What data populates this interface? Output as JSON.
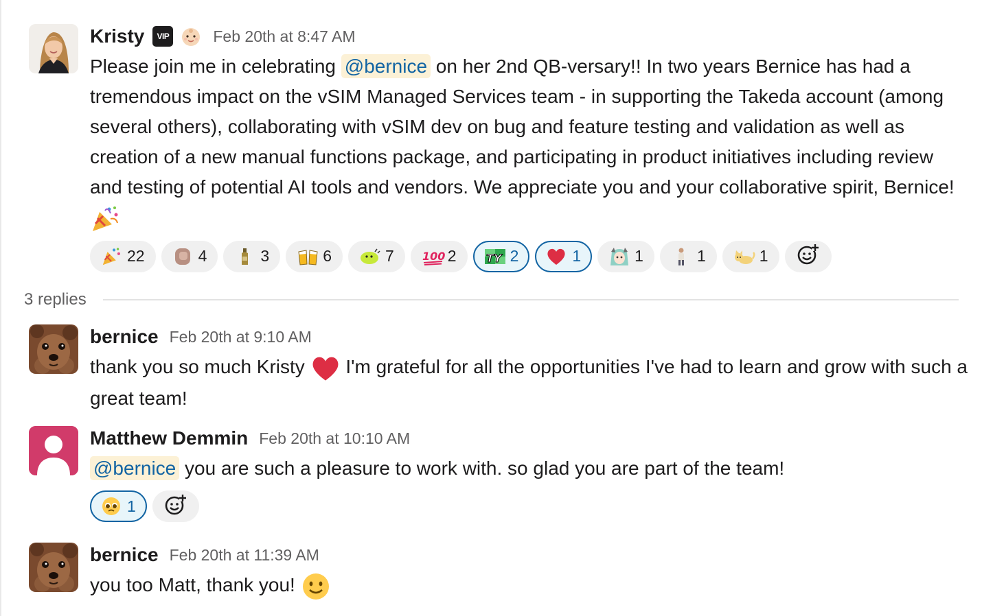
{
  "main_message": {
    "author": "Kristy",
    "badge": "VIP",
    "timestamp": "Feb 20th at 8:47 AM",
    "text_before": "Please join me in celebrating ",
    "mention": "@bernice",
    "text_after": " on her 2nd QB-versary!! In two years Bernice has had a tremendous impact on the vSIM Managed Services team - in supporting the Takeda account (among several others), collaborating with vSIM dev on bug and feature testing and validation as well as creation of a new manual functions package, and participating in product initiatives including review and testing of potential AI tools and vendors. We appreciate you and your collaborative spirit, Bernice! ",
    "reactions": [
      {
        "emoji": "party-popper",
        "count": "22",
        "mine": false
      },
      {
        "emoji": "custom-face",
        "count": "4",
        "mine": false
      },
      {
        "emoji": "bottle",
        "count": "3",
        "mine": false
      },
      {
        "emoji": "beers",
        "count": "6",
        "mine": false
      },
      {
        "emoji": "blob-dance",
        "count": "7",
        "mine": false
      },
      {
        "emoji": "hundred",
        "count": "2",
        "mine": false
      },
      {
        "emoji": "ty",
        "count": "2",
        "mine": true
      },
      {
        "emoji": "red-heart",
        "count": "1",
        "mine": true
      },
      {
        "emoji": "anime-girl",
        "count": "1",
        "mine": false
      },
      {
        "emoji": "person-standing",
        "count": "1",
        "mine": false
      },
      {
        "emoji": "cat",
        "count": "1",
        "mine": false
      }
    ]
  },
  "thread": {
    "replies_label": "3 replies"
  },
  "replies": [
    {
      "author": "bernice",
      "timestamp": "Feb 20th at 9:10 AM",
      "text_before": "thank you so much Kristy ",
      "text_after": " I'm grateful for all the opportunities  I've had to learn and grow with  such a great team!"
    },
    {
      "author": "Matthew Demmin",
      "timestamp": "Feb 20th at 10:10 AM",
      "mention": "@bernice",
      "text_after": " you are such a pleasure to work with. so glad you are part of the team!",
      "reactions": [
        {
          "emoji": "pleading-face",
          "count": "1",
          "mine": true
        }
      ]
    },
    {
      "author": "bernice",
      "timestamp": "Feb 20th at 11:39 AM",
      "text_before": "you too Matt, thank you! "
    }
  ],
  "colors": {
    "link": "#1264a3",
    "mention_bg": "#fcf1d6",
    "reaction_bg": "#f0f0f0",
    "reaction_mine_bg": "#e8f5fa",
    "timestamp": "#616061",
    "matthew_avatar": "#d13b6a"
  }
}
